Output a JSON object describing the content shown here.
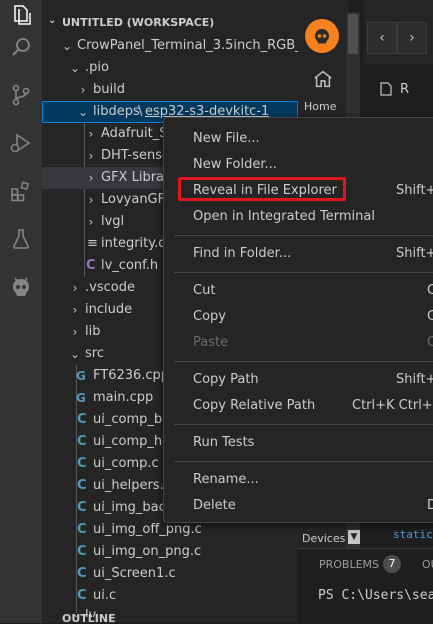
{
  "workspace": {
    "title": "UNTITLED (WORKSPACE)",
    "bottom_section": "OUTLINE"
  },
  "tree": {
    "root": "CrowPanel_Terminal_3.5inch_RGB_Ca...",
    "pio": ".pio",
    "build": "build",
    "libdeps": "libdeps",
    "libdeps_env": "esp32-s3-devkitc-1",
    "libdeps_children": [
      "Adafruit_Se",
      "DHT-senso",
      "GFX Library",
      "LovyanGFX",
      "lvgl",
      "integrity.da",
      "lv_conf.h"
    ],
    "vscode": ".vscode",
    "include": "include",
    "lib": "lib",
    "src": "src",
    "src_files": [
      "FT6236.cpp",
      "main.cpp",
      "ui_comp_bu",
      "ui_comp_ho",
      "ui_comp.c",
      "ui_helpers.c",
      "ui_img_back",
      "ui_img_off_png.c",
      "ui_img_on_png.c",
      "ui_Screen1.c",
      "ui.c"
    ],
    "cut_off": "lv_..."
  },
  "platformio": {
    "home_label": "Home",
    "devices_label": "Devices"
  },
  "editor": {
    "tab_letter": "R",
    "code_snippet": "static"
  },
  "panel": {
    "problems_label": "PROBLEMS",
    "problems_count": "7",
    "output_label": "OU",
    "terminal_line": "PS C:\\Users\\sea"
  },
  "context_menu": {
    "items": [
      {
        "label": "New File...",
        "shortcut": ""
      },
      {
        "label": "New Folder...",
        "shortcut": ""
      },
      {
        "label": "Reveal in File Explorer",
        "shortcut": "Shift+A"
      },
      {
        "label": "Open in Integrated Terminal",
        "shortcut": ""
      },
      {
        "label": "Find in Folder...",
        "shortcut": "Shift+"
      },
      {
        "label": "Cut",
        "shortcut": "C"
      },
      {
        "label": "Copy",
        "shortcut": "C"
      },
      {
        "label": "Paste",
        "shortcut": "C"
      },
      {
        "label": "Copy Path",
        "shortcut": "Shift+A"
      },
      {
        "label": "Copy Relative Path",
        "shortcut": "Ctrl+K Ctrl+Sh"
      },
      {
        "label": "Run Tests",
        "shortcut": ""
      },
      {
        "label": "Rename...",
        "shortcut": ""
      },
      {
        "label": "Delete",
        "shortcut": "D"
      }
    ],
    "highlighted_item": "Reveal in File Explorer",
    "highlight_color": "#e0151e"
  },
  "colors": {
    "activity_bar": "#333333",
    "sidebar": "#252526",
    "editor_bg": "#1e1e1e",
    "focus_border": "#007fd4",
    "platformio_orange": "#f5821f"
  }
}
